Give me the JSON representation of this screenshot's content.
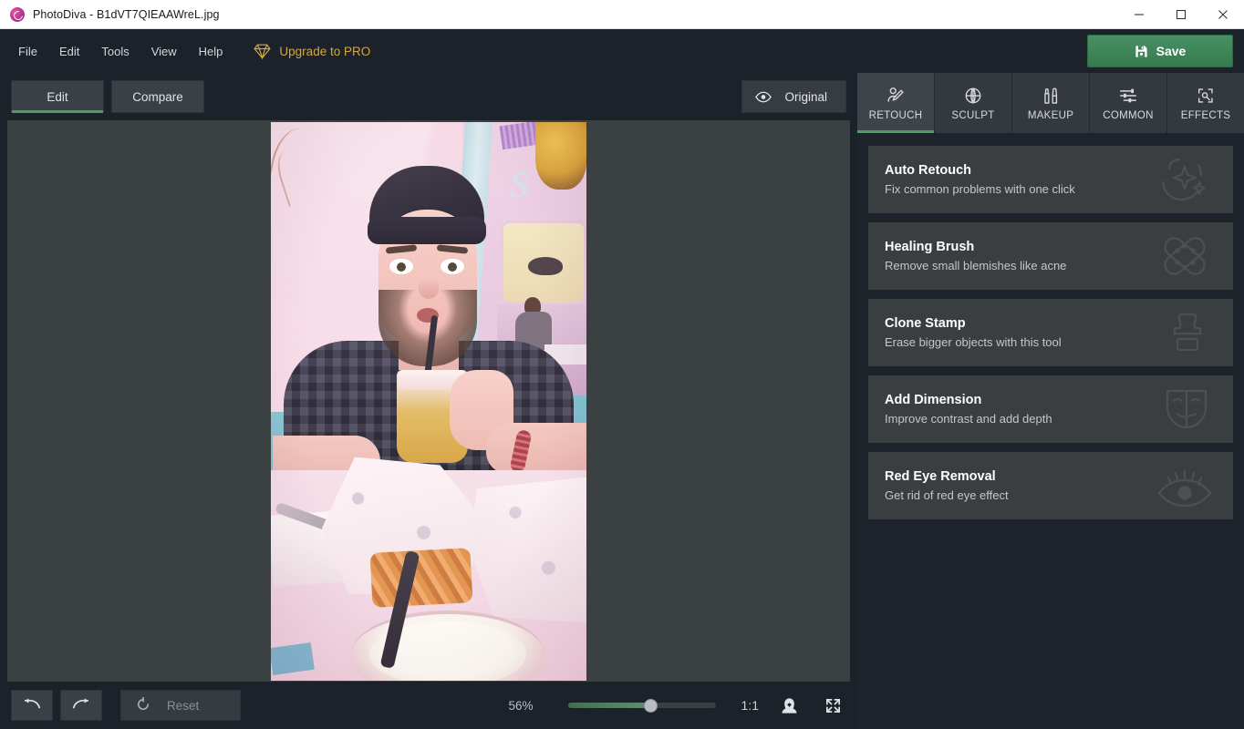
{
  "window": {
    "title": "PhotoDiva - B1dVT7QIEAAWreL.jpg",
    "app_icon": "photodiva-logo-icon",
    "minimize_label": "—",
    "maximize_label": "□",
    "close_label": "×"
  },
  "menubar": {
    "items": [
      {
        "label": "File"
      },
      {
        "label": "Edit"
      },
      {
        "label": "Tools"
      },
      {
        "label": "View"
      },
      {
        "label": "Help"
      }
    ],
    "upgrade_label": "Upgrade to PRO",
    "upgrade_icon": "diamond-icon",
    "upgrade_color": "#d5a83f",
    "save_label": "Save",
    "save_icon": "floppy-disk-icon",
    "save_color": "#3d8356"
  },
  "topbar": {
    "tabs": [
      {
        "label": "Edit",
        "active": true
      },
      {
        "label": "Compare",
        "active": false
      }
    ],
    "original_label": "Original",
    "original_icon": "eye-icon",
    "accent_color": "#4d9f61"
  },
  "canvas": {
    "photo_alt": "Man in beanie drinking from a straw at a diner table with fries"
  },
  "bottombar": {
    "undo_icon": "undo-arrow-icon",
    "redo_icon": "redo-arrow-icon",
    "reset_label": "Reset",
    "reset_icon": "reset-circular-arrow-icon",
    "zoom_percent": "56%",
    "zoom_value": 56,
    "one_to_one_label": "1:1",
    "fit_face_icon": "portrait-face-icon",
    "fullscreen_icon": "expand-arrows-icon"
  },
  "right_panel": {
    "tabs": [
      {
        "label": "RETOUCH",
        "icon": "face-retouch-icon",
        "active": true
      },
      {
        "label": "SCULPT",
        "icon": "sculpt-globe-icon",
        "active": false
      },
      {
        "label": "MAKEUP",
        "icon": "makeup-lipstick-icon",
        "active": false
      },
      {
        "label": "COMMON",
        "icon": "sliders-icon",
        "active": false
      },
      {
        "label": "EFFECTS",
        "icon": "effects-magic-frame-icon",
        "active": false
      }
    ],
    "cards": [
      {
        "title": "Auto Retouch",
        "subtitle": "Fix common problems with one click",
        "icon": "sparkle-face-icon"
      },
      {
        "title": "Healing Brush",
        "subtitle": "Remove small blemishes like acne",
        "icon": "bandage-cross-icon"
      },
      {
        "title": "Clone Stamp",
        "subtitle": "Erase bigger objects with this tool",
        "icon": "stamp-icon"
      },
      {
        "title": "Add Dimension",
        "subtitle": "Improve contrast and add depth",
        "icon": "theater-mask-icon"
      },
      {
        "title": "Red Eye Removal",
        "subtitle": "Get rid of red eye effect",
        "icon": "eye-rays-icon"
      }
    ]
  },
  "colors": {
    "chrome_bg": "#1c222a",
    "panel_bg": "#1e242c",
    "card_bg": "#3a3e41",
    "canvas_bg": "#3b4142",
    "accent_green": "#4d9f61",
    "gold": "#d5a83f"
  }
}
